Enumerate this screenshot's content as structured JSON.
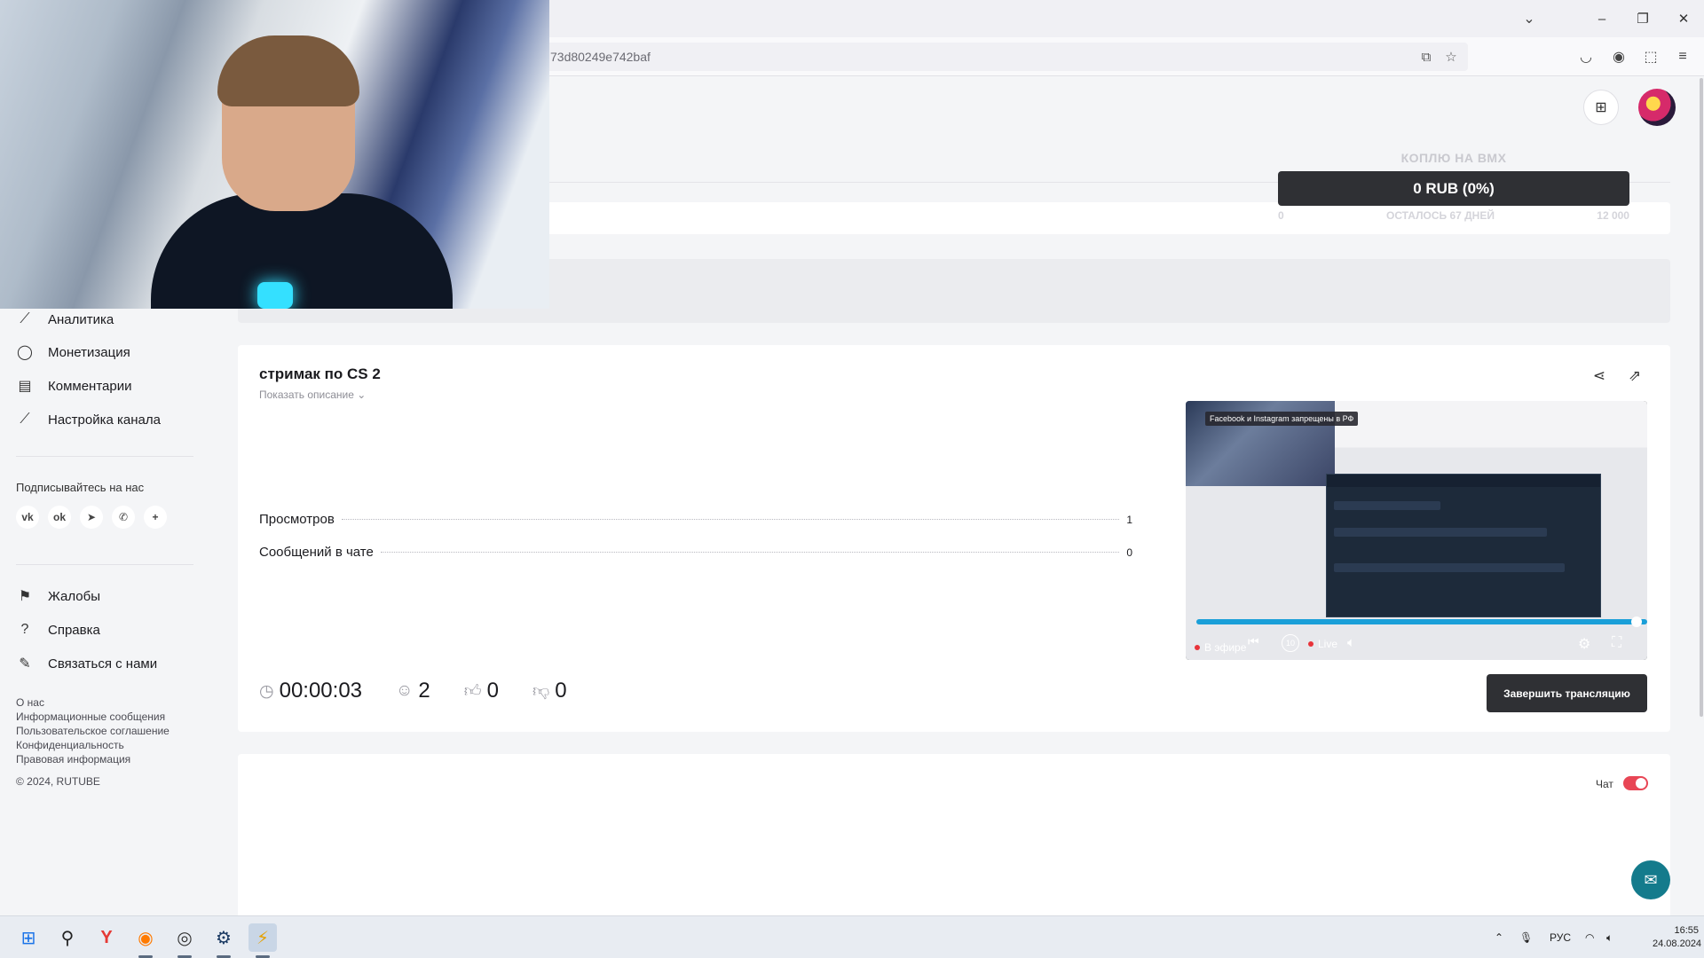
{
  "browser": {
    "url": "73d80249e742baf",
    "window_controls": [
      "minimize",
      "restore",
      "close"
    ]
  },
  "donation": {
    "title": "КОПЛЮ НА BMX",
    "amount": "0 RUB (0%)",
    "min": "0",
    "remaining": "ОСТАЛОСЬ 67 ДНЕЙ",
    "max": "12 000",
    "progress_fraction": 0
  },
  "sidebar": {
    "items": [
      {
        "label": "Аналитика",
        "icon": "chart-icon"
      },
      {
        "label": "Монетизация",
        "icon": "coin-icon"
      },
      {
        "label": "Комментарии",
        "icon": "comments-icon"
      },
      {
        "label": "Настройка канала",
        "icon": "wand-icon"
      }
    ],
    "follow_title": "Подписывайтесь на нас",
    "socials": [
      "vk",
      "ok",
      "telegram",
      "viber",
      "+"
    ],
    "support_items": [
      {
        "label": "Жалобы",
        "icon": "flag-icon"
      },
      {
        "label": "Справка",
        "icon": "help-icon"
      },
      {
        "label": "Связаться с нами",
        "icon": "pen-icon"
      }
    ],
    "footer_links": [
      "О нас",
      "Информационные сообщения",
      "Пользовательское соглашение",
      "Конфиденциальность",
      "Правовая информация"
    ],
    "copyright": "© 2024, RUTUBE"
  },
  "stream": {
    "title": "стримак по CS 2",
    "show_description": "Показать описание",
    "stats": [
      {
        "label": "Просмотров",
        "value": "1"
      },
      {
        "label": "Сообщений в чате",
        "value": "0"
      }
    ],
    "duration": "00:00:03",
    "viewers": "2",
    "likes": "0",
    "dislikes": "0",
    "end_button": "Завершить трансляцию"
  },
  "player": {
    "banner": "Facebook и Instagram запрещены в РФ",
    "live_status": "В эфире",
    "live_label": "Live",
    "rewind_label": "10",
    "progress_fraction": 1.0
  },
  "chat": {
    "label": "Чат",
    "enabled": true
  },
  "taskbar": {
    "lang": "РУС",
    "time": "16:55",
    "date": "24.08.2024"
  },
  "colors": {
    "accent_dark": "#2f3034",
    "progress_blue": "#1a9fd8",
    "toggle_red": "#e84655",
    "support_teal": "#147b8c"
  }
}
